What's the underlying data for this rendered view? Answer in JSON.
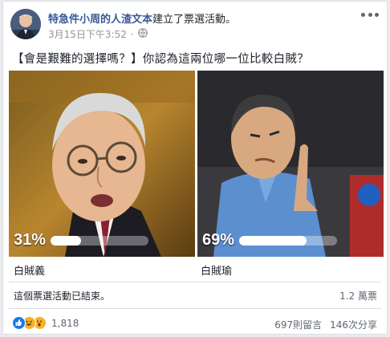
{
  "post": {
    "page_name": "特急件小周的人渣文本",
    "action": "建立了票選活動。",
    "timestamp": "3月15日下午3:52",
    "dot": "·",
    "audience_icon": "globe-icon",
    "question": "【會是艱難的選擇嗎？】你認為這兩位哪一位比較白賊？"
  },
  "poll": {
    "options": [
      {
        "label": "白賊義",
        "percent_text": "31%",
        "percent": 31
      },
      {
        "label": "白賊瑜",
        "percent_text": "69%",
        "percent": 69
      }
    ],
    "status": "這個票選活動已結束。",
    "votes": "1.2 萬票"
  },
  "footer": {
    "reactions": [
      "like-icon",
      "haha-icon",
      "wow-icon"
    ],
    "reaction_count": "1,818",
    "comments": "697則留言",
    "shares": "146次分享"
  },
  "colors": {
    "link": "#385898",
    "like": "#1877f2",
    "reaction_yellow": "#f7b125"
  }
}
